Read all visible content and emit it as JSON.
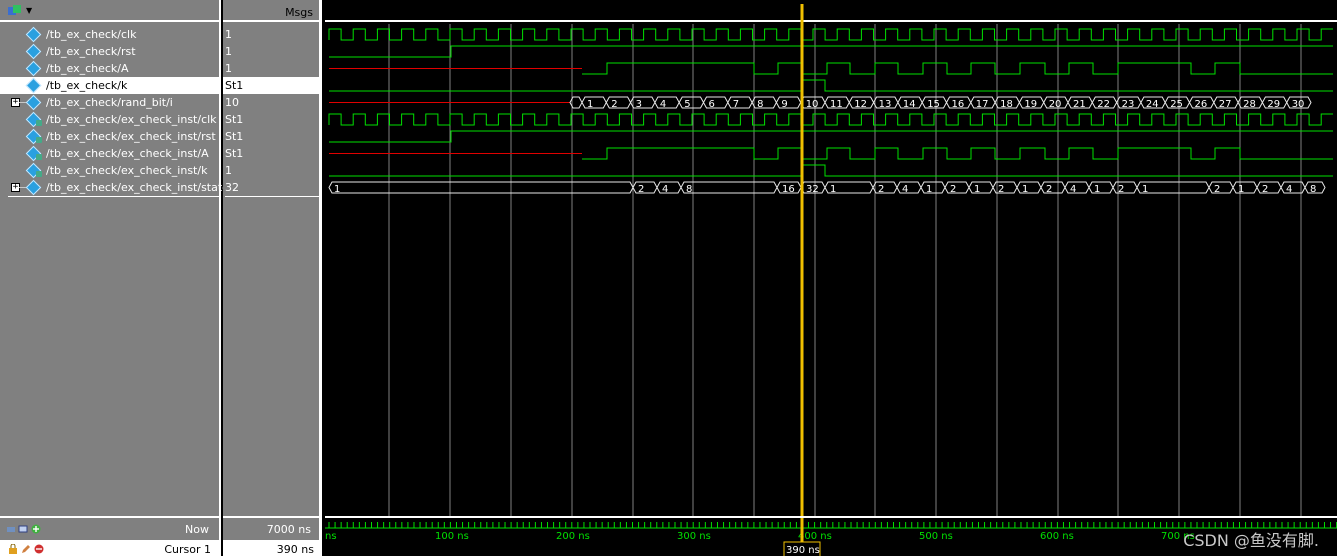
{
  "header": {
    "msgs_label": "Msgs"
  },
  "signals": [
    {
      "name": "/tb_ex_check/clk",
      "value": "1",
      "expandable": false,
      "instance": false
    },
    {
      "name": "/tb_ex_check/rst",
      "value": "1",
      "expandable": false,
      "instance": false
    },
    {
      "name": "/tb_ex_check/A",
      "value": "1",
      "expandable": false,
      "instance": false
    },
    {
      "name": "/tb_ex_check/k",
      "value": "St1",
      "expandable": false,
      "instance": false,
      "selected": true
    },
    {
      "name": "/tb_ex_check/rand_bit/i",
      "value": "10",
      "expandable": true,
      "instance": false
    },
    {
      "name": "/tb_ex_check/ex_check_inst/clk",
      "value": "St1",
      "expandable": false,
      "instance": true
    },
    {
      "name": "/tb_ex_check/ex_check_inst/rst",
      "value": "St1",
      "expandable": false,
      "instance": true
    },
    {
      "name": "/tb_ex_check/ex_check_inst/A",
      "value": "St1",
      "expandable": false,
      "instance": true
    },
    {
      "name": "/tb_ex_check/ex_check_inst/k",
      "value": "1",
      "expandable": false,
      "instance": true
    },
    {
      "name": "/tb_ex_check/ex_check_inst/state",
      "value": "32",
      "expandable": true,
      "instance": false
    }
  ],
  "bottom": {
    "now_label": "Now",
    "now_value": "7000 ns",
    "cursor_label": "Cursor 1",
    "cursor_value": "390 ns",
    "cursor_flag": "390 ns"
  },
  "timeline": {
    "tick_labels": [
      "ns",
      "100 ns",
      "200 ns",
      "300 ns",
      "",
      "500 ns",
      "600 ns",
      "700 ns"
    ],
    "cursor_axis_label": "400 ns"
  },
  "waves": {
    "rand_bit_i_labels": [
      "1",
      "2",
      "3",
      "4",
      "5",
      "6",
      "7",
      "8",
      "9",
      "10",
      "11",
      "12",
      "13",
      "14",
      "15",
      "16",
      "17",
      "18",
      "19",
      "20",
      "21",
      "22",
      "23",
      "24",
      "25",
      "26",
      "27",
      "28",
      "29",
      "30"
    ],
    "state_labels": [
      "1",
      "2",
      "4",
      "8",
      "16",
      "32",
      "1",
      "2",
      "4",
      "1",
      "2",
      "1",
      "2",
      "1",
      "2",
      "4",
      "1",
      "2",
      "1",
      "2",
      "1",
      "2",
      "4",
      "8"
    ]
  },
  "watermark": "CSDN @鱼没有脚.",
  "colors": {
    "wave_green": "#00e000",
    "wave_red": "#e00000",
    "cursor_yellow": "#f0c000",
    "grid": "#808080"
  }
}
